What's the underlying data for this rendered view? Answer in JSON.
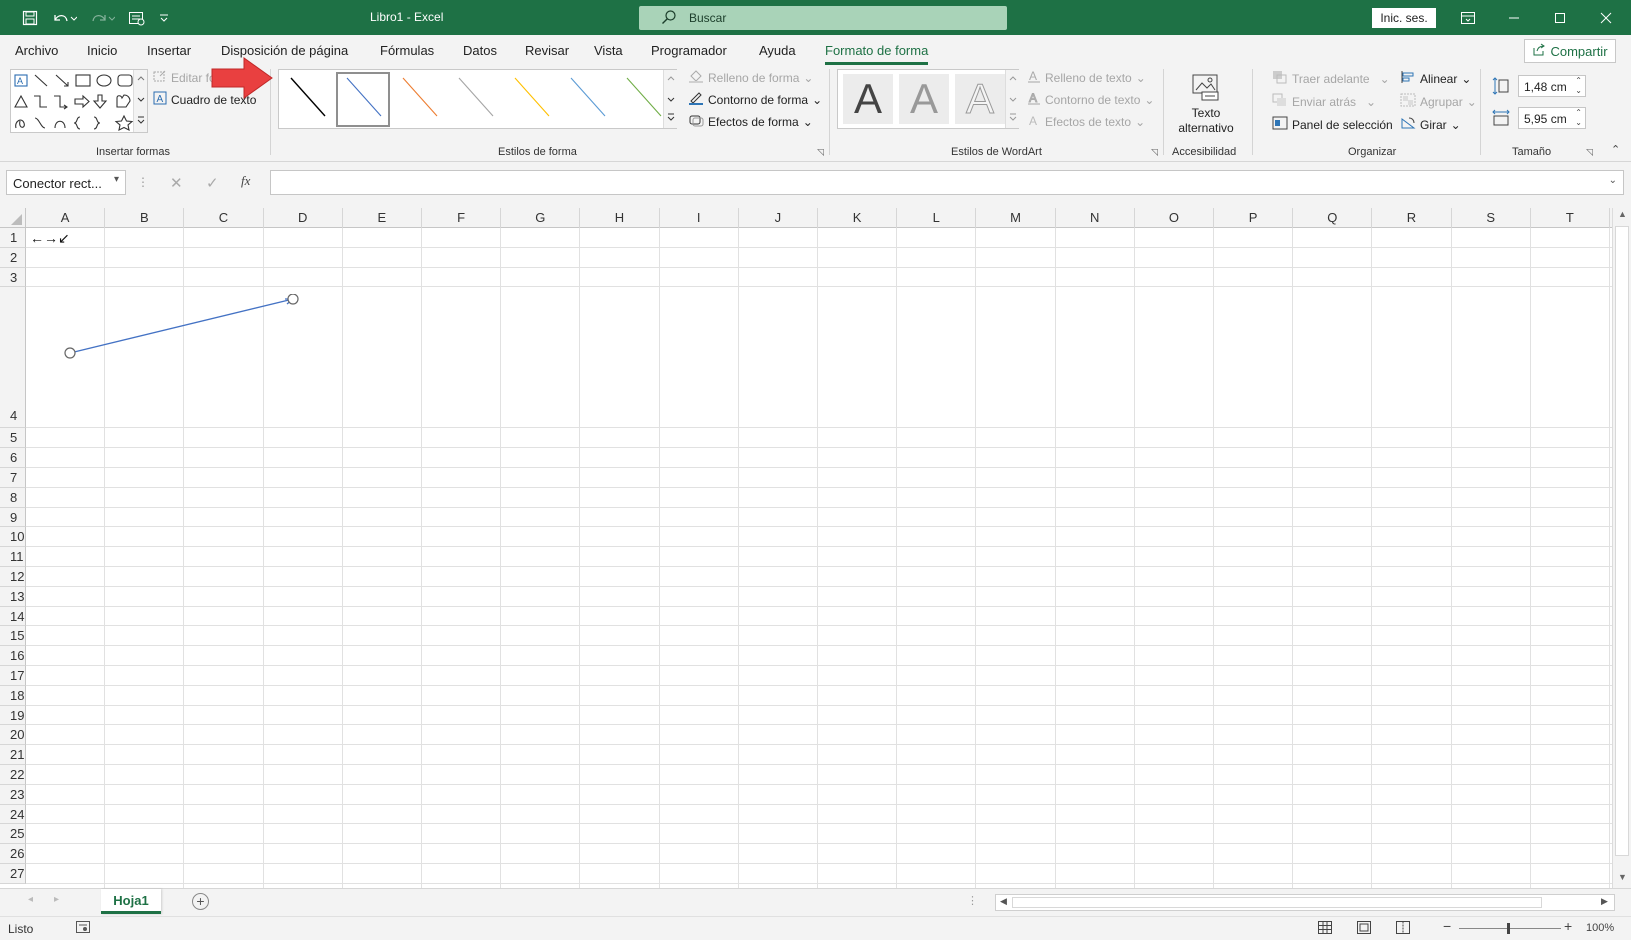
{
  "titlebar": {
    "title": "Libro1  -  Excel",
    "search_placeholder": "Buscar",
    "signin_label": "Inic. ses."
  },
  "tabs": [
    {
      "label": "Archivo"
    },
    {
      "label": "Inicio"
    },
    {
      "label": "Insertar"
    },
    {
      "label": "Disposición de página"
    },
    {
      "label": "Fórmulas"
    },
    {
      "label": "Datos"
    },
    {
      "label": "Revisar"
    },
    {
      "label": "Vista"
    },
    {
      "label": "Programador"
    },
    {
      "label": "Ayuda"
    },
    {
      "label": "Formato de forma",
      "active": true
    }
  ],
  "share_label": "Compartir",
  "ribbon": {
    "insert_shapes": {
      "edit_shape": "Editar forma",
      "text_box": "Cuadro de texto",
      "group_label": "Insertar formas"
    },
    "shape_styles": {
      "line_colors": [
        "#000000",
        "#4472c4",
        "#ed7d31",
        "#a5a5a5",
        "#ffc000",
        "#5b9bd5",
        "#70ad47"
      ],
      "fill": "Relleno de forma",
      "outline": "Contorno de forma",
      "effects": "Efectos de forma",
      "group_label": "Estilos de forma"
    },
    "wordart": {
      "letters": [
        "A",
        "A",
        "A"
      ],
      "text_fill": "Relleno de texto",
      "text_outline": "Contorno de texto",
      "text_effects": "Efectos de texto",
      "group_label": "Estilos de WordArt"
    },
    "accessibility": {
      "alt_text_line1": "Texto",
      "alt_text_line2": "alternativo",
      "group_label": "Accesibilidad"
    },
    "arrange": {
      "bring_forward": "Traer adelante",
      "send_backward": "Enviar atrás",
      "selection_pane": "Panel de selección",
      "align": "Alinear",
      "group": "Agrupar",
      "rotate": "Girar",
      "group_label": "Organizar"
    },
    "size": {
      "height": "1,48 cm",
      "width": "5,95 cm",
      "group_label": "Tamaño"
    }
  },
  "formula_bar": {
    "name_box": "Conector rect...",
    "fx": "fx",
    "value": ""
  },
  "grid": {
    "columns": [
      "A",
      "B",
      "C",
      "D",
      "E",
      "F",
      "G",
      "H",
      "I",
      "J",
      "K",
      "L",
      "M",
      "N",
      "O",
      "P",
      "Q",
      "R",
      "S",
      "T"
    ],
    "rows": [
      "1",
      "2",
      "3",
      "4",
      "5",
      "6",
      "7",
      "8",
      "9",
      "10",
      "11",
      "12",
      "13",
      "14",
      "15",
      "16",
      "17",
      "18",
      "19",
      "20",
      "21",
      "22",
      "23",
      "24",
      "25",
      "26",
      "27"
    ],
    "cell_a1": "←→↙"
  },
  "sheet_tab": "Hoja1",
  "status": {
    "ready": "Listo",
    "zoom": "100%"
  },
  "colors": {
    "excel_green": "#1e7145",
    "connector_line": "#4472c4",
    "annotation_arrow": "#e94040"
  }
}
